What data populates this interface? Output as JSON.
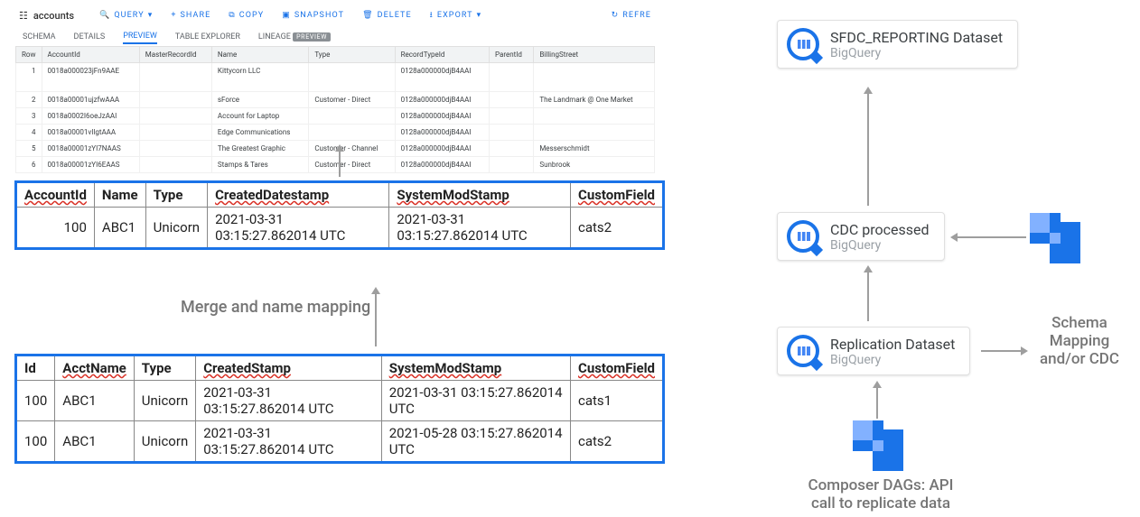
{
  "bq": {
    "title": "accounts",
    "actions": {
      "query": "QUERY",
      "share": "SHARE",
      "copy": "COPY",
      "snapshot": "SNAPSHOT",
      "delete": "DELETE",
      "export": "EXPORT",
      "refresh": "REFRE"
    },
    "tabs": {
      "schema": "SCHEMA",
      "details": "DETAILS",
      "preview": "PREVIEW",
      "table_explorer": "TABLE EXPLORER",
      "lineage": "LINEAGE",
      "preview_badge": "PREVIEW"
    },
    "columns": [
      "Row",
      "AccountId",
      "MasterRecordId",
      "Name",
      "Type",
      "RecordTypeId",
      "ParentId",
      "BillingStreet"
    ],
    "rows": [
      {
        "row": "1",
        "AccountId": "0018a000023jFn9AAE",
        "MasterRecordId": "",
        "Name": "Kittycorn LLC",
        "Type": "",
        "RecordTypeId": "0128a000000djB4AAI",
        "ParentId": "",
        "BillingStreet": ""
      },
      {
        "row": "2",
        "AccountId": "0018a00001ujzfwAAA",
        "MasterRecordId": "",
        "Name": "sForce",
        "Type": "Customer - Direct",
        "RecordTypeId": "0128a000000djB4AAI",
        "ParentId": "",
        "BillingStreet": "The Landmark @ One Market"
      },
      {
        "row": "3",
        "AccountId": "0018a0002I6oeJzAAI",
        "MasterRecordId": "",
        "Name": "Account for Laptop",
        "Type": "",
        "RecordTypeId": "0128a000000djB4AAI",
        "ParentId": "",
        "BillingStreet": ""
      },
      {
        "row": "4",
        "AccountId": "0018a00001vIlgtAAA",
        "MasterRecordId": "",
        "Name": "Edge Communications",
        "Type": "",
        "RecordTypeId": "0128a000000djB4AAI",
        "ParentId": "",
        "BillingStreet": ""
      },
      {
        "row": "5",
        "AccountId": "0018a00001zYI7NAAS",
        "MasterRecordId": "",
        "Name": "The Greatest Graphic",
        "Type": "Customer - Channel",
        "RecordTypeId": "0128a000000djB4AAI",
        "ParentId": "",
        "BillingStreet": "Messerschmidt"
      },
      {
        "row": "6",
        "AccountId": "0018a00001zYI6EAAS",
        "MasterRecordId": "",
        "Name": "Stamps & Tares",
        "Type": "Customer - Direct",
        "RecordTypeId": "0128a000000djB4AAI",
        "ParentId": "",
        "BillingStreet": "Sunbrook"
      }
    ]
  },
  "mapped": {
    "headers": {
      "AccountId": "AccountId",
      "Name": "Name",
      "Type": "Type",
      "CreatedDatestamp": "CreatedDatestamp",
      "SystemModStamp": "SystemModStamp",
      "CustomField": "CustomField"
    },
    "row": {
      "AccountId": "100",
      "Name": "ABC1",
      "Type": "Unicorn",
      "CreatedDatestamp": "2021-03-31 03:15:27.862014 UTC",
      "SystemModStamp": "2021-03-31 03:15:27.862014 UTC",
      "CustomField": "cats2"
    }
  },
  "merge_label": "Merge and name mapping",
  "source": {
    "headers": {
      "Id": "Id",
      "AcctName": "AcctName",
      "Type": "Type",
      "CreatedStamp": "CreatedStamp",
      "SystemModStamp": "SystemModStamp",
      "CustomField": "CustomField"
    },
    "rows": [
      {
        "Id": "100",
        "AcctName": "ABC1",
        "Type": "Unicorn",
        "CreatedStamp": "2021-03-31 03:15:27.862014 UTC",
        "SystemModStamp": "2021-03-31 03:15:27.862014 UTC",
        "CustomField": "cats1"
      },
      {
        "Id": "100",
        "AcctName": "ABC1",
        "Type": "Unicorn",
        "CreatedStamp": "2021-03-31 03:15:27.862014 UTC",
        "SystemModStamp": "2021-05-28 03:15:27.862014 UTC",
        "CustomField": "cats2"
      }
    ]
  },
  "right": {
    "sfdc": {
      "title": "SFDC_REPORTING Dataset",
      "sub": "BigQuery"
    },
    "cdc": {
      "title": "CDC processed",
      "sub": "BigQuery"
    },
    "repl": {
      "title": "Replication Dataset",
      "sub": "BigQuery"
    },
    "schema_label": "Schema Mapping and/or CDC",
    "composer_label": "Composer DAGs: API call to replicate data"
  }
}
